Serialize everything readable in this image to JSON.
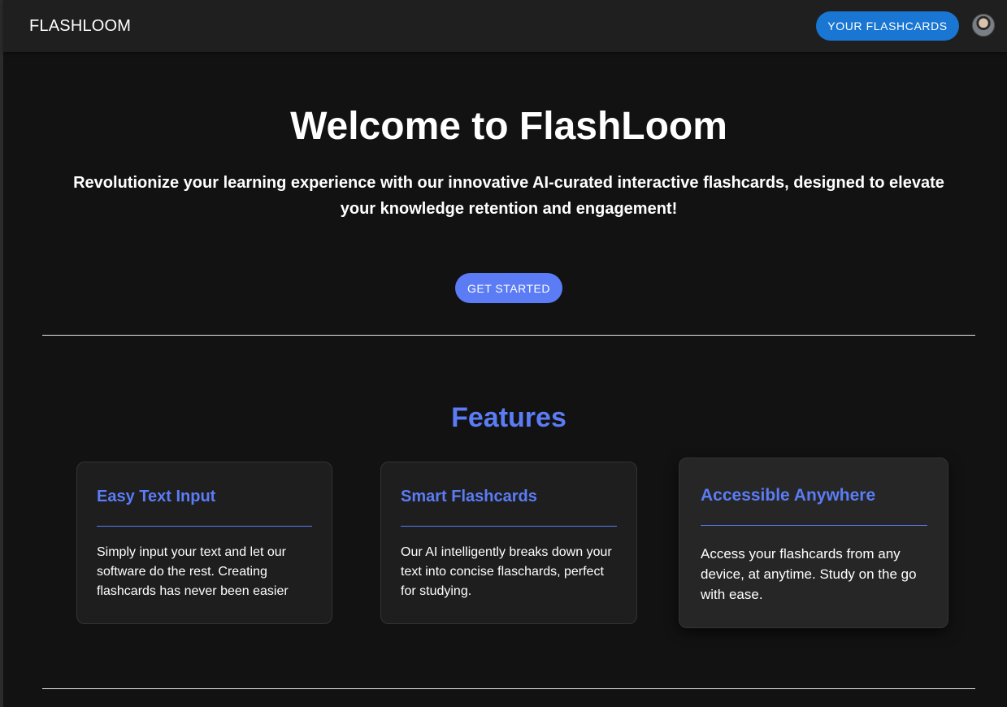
{
  "appbar": {
    "brand": "FLASHLOOM",
    "flashcards_button": "YOUR FLASHCARDS"
  },
  "hero": {
    "title": "Welcome to FlashLoom",
    "subtitle": "Revolutionize your learning experience with our innovative AI-curated interactive flashcards, designed to elevate your knowledge retention and engagement!",
    "cta": "GET STARTED"
  },
  "features": {
    "title": "Features",
    "cards": [
      {
        "title": "Easy Text Input",
        "text": "Simply input your text and let our software do the rest. Creating flashcards has never been easier"
      },
      {
        "title": "Smart Flashcards",
        "text": "Our AI intelligently breaks down your text into concise flaschards, perfect for studying."
      },
      {
        "title": "Accessible Anywhere",
        "text": "Access your flashcards from any device, at anytime. Study on the go with ease."
      }
    ]
  },
  "colors": {
    "accent": "#5b7cf5",
    "appbar_button": "#1976d2",
    "background": "#121212"
  }
}
